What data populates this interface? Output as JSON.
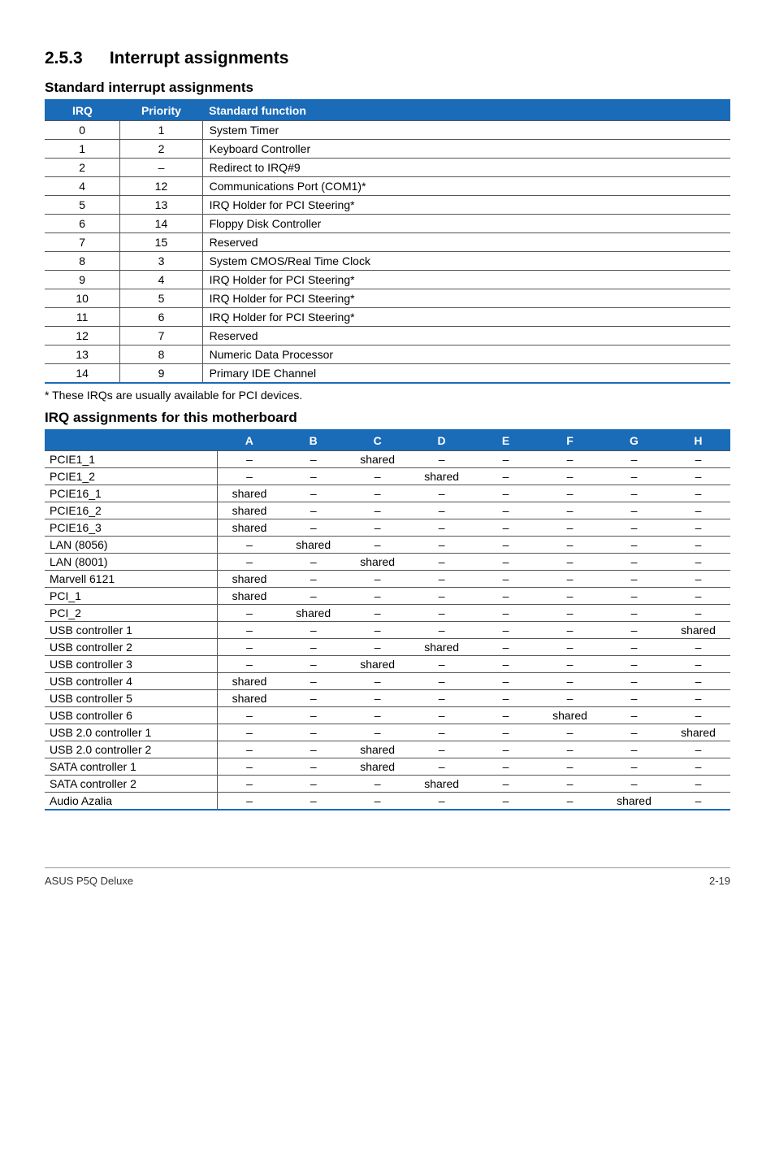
{
  "section": {
    "number": "2.5.3",
    "title": "Interrupt assignments"
  },
  "std_table": {
    "heading": "Standard interrupt assignments",
    "headers": {
      "irq": "IRQ",
      "priority": "Priority",
      "function": "Standard function"
    },
    "rows": [
      {
        "irq": "0",
        "priority": "1",
        "func": "System Timer"
      },
      {
        "irq": "1",
        "priority": "2",
        "func": "Keyboard Controller"
      },
      {
        "irq": "2",
        "priority": "–",
        "func": "Redirect to IRQ#9"
      },
      {
        "irq": "4",
        "priority": "12",
        "func": "Communications Port (COM1)*"
      },
      {
        "irq": "5",
        "priority": "13",
        "func": "IRQ Holder for PCI Steering*"
      },
      {
        "irq": "6",
        "priority": "14",
        "func": "Floppy Disk Controller"
      },
      {
        "irq": "7",
        "priority": "15",
        "func": "Reserved"
      },
      {
        "irq": "8",
        "priority": "3",
        "func": "System CMOS/Real Time Clock"
      },
      {
        "irq": "9",
        "priority": "4",
        "func": "IRQ Holder for PCI Steering*"
      },
      {
        "irq": "10",
        "priority": "5",
        "func": "IRQ Holder for PCI Steering*"
      },
      {
        "irq": "11",
        "priority": "6",
        "func": "IRQ Holder for PCI Steering*"
      },
      {
        "irq": "12",
        "priority": "7",
        "func": "Reserved"
      },
      {
        "irq": "13",
        "priority": "8",
        "func": "Numeric Data Processor"
      },
      {
        "irq": "14",
        "priority": "9",
        "func": "Primary IDE Channel"
      }
    ],
    "footnote": "* These IRQs are usually available for PCI devices."
  },
  "irq_table": {
    "heading": "IRQ assignments for this motherboard",
    "headers": [
      "",
      "A",
      "B",
      "C",
      "D",
      "E",
      "F",
      "G",
      "H"
    ],
    "rows": [
      {
        "name": "PCIE1_1",
        "vals": [
          "–",
          "–",
          "shared",
          "–",
          "–",
          "–",
          "–",
          "–"
        ]
      },
      {
        "name": "PCIE1_2",
        "vals": [
          "–",
          "–",
          "–",
          "shared",
          "–",
          "–",
          "–",
          "–"
        ]
      },
      {
        "name": "PCIE16_1",
        "vals": [
          "shared",
          "–",
          "–",
          "–",
          "–",
          "–",
          "–",
          "–"
        ]
      },
      {
        "name": "PCIE16_2",
        "vals": [
          "shared",
          "–",
          "–",
          "–",
          "–",
          "–",
          "–",
          "–"
        ]
      },
      {
        "name": "PCIE16_3",
        "vals": [
          "shared",
          "–",
          "–",
          "–",
          "–",
          "–",
          "–",
          "–"
        ]
      },
      {
        "name": "LAN (8056)",
        "vals": [
          "–",
          "shared",
          "–",
          "–",
          "–",
          "–",
          "–",
          "–"
        ]
      },
      {
        "name": "LAN (8001)",
        "vals": [
          "–",
          "–",
          "shared",
          "–",
          "–",
          "–",
          "–",
          "–"
        ]
      },
      {
        "name": "Marvell 6121",
        "vals": [
          "shared",
          "–",
          "–",
          "–",
          "–",
          "–",
          "–",
          "–"
        ]
      },
      {
        "name": "PCI_1",
        "vals": [
          "shared",
          "–",
          "–",
          "–",
          "–",
          "–",
          "–",
          "–"
        ]
      },
      {
        "name": "PCI_2",
        "vals": [
          "–",
          "shared",
          "–",
          "–",
          "–",
          "–",
          "–",
          "–"
        ]
      },
      {
        "name": "USB controller 1",
        "vals": [
          "–",
          "–",
          "–",
          "–",
          "–",
          "–",
          "–",
          "shared"
        ]
      },
      {
        "name": "USB controller 2",
        "vals": [
          "–",
          "–",
          "–",
          "shared",
          "–",
          "–",
          "–",
          "–"
        ]
      },
      {
        "name": "USB controller 3",
        "vals": [
          "–",
          "–",
          "shared",
          "–",
          "–",
          "–",
          "–",
          "–"
        ]
      },
      {
        "name": "USB controller 4",
        "vals": [
          "shared",
          "–",
          "–",
          "–",
          "–",
          "–",
          "–",
          "–"
        ]
      },
      {
        "name": "USB controller 5",
        "vals": [
          "shared",
          "–",
          "–",
          "–",
          "–",
          "–",
          "–",
          "–"
        ]
      },
      {
        "name": "USB controller 6",
        "vals": [
          "–",
          "–",
          "–",
          "–",
          "–",
          "shared",
          "–",
          "–"
        ]
      },
      {
        "name": "USB 2.0 controller 1",
        "vals": [
          "–",
          "–",
          "–",
          "–",
          "–",
          "–",
          "–",
          "shared"
        ]
      },
      {
        "name": "USB 2.0 controller 2",
        "vals": [
          "–",
          "–",
          "shared",
          "–",
          "–",
          "–",
          "–",
          "–"
        ]
      },
      {
        "name": "SATA controller 1",
        "vals": [
          "–",
          "–",
          "shared",
          "–",
          "–",
          "–",
          "–",
          "–"
        ]
      },
      {
        "name": "SATA controller 2",
        "vals": [
          "–",
          "–",
          "–",
          "shared",
          "–",
          "–",
          "–",
          "–"
        ]
      },
      {
        "name": "Audio Azalia",
        "vals": [
          "–",
          "–",
          "–",
          "–",
          "–",
          "–",
          "shared",
          "–"
        ]
      }
    ]
  },
  "footer": {
    "left": "ASUS P5Q Deluxe",
    "right": "2-19"
  }
}
